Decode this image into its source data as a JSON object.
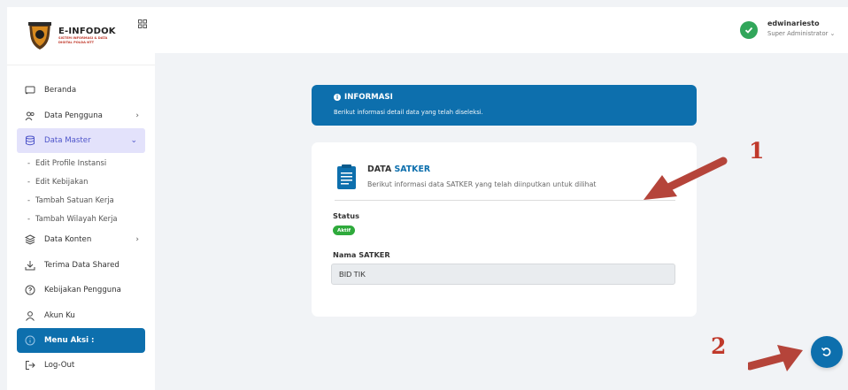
{
  "brand": {
    "title": "E-INFODOK",
    "subtitle": "SISTEM INFORMASI & DATA DIGITAL POLDA NTT"
  },
  "sidebar": {
    "items": [
      {
        "label": "Beranda",
        "icon": "cast-icon"
      },
      {
        "label": "Data Pengguna",
        "icon": "users-icon",
        "chevron": "›"
      },
      {
        "label": "Data Master",
        "icon": "database-icon",
        "chevron": "⌄",
        "active": true
      },
      {
        "label": "Data Konten",
        "icon": "layers-icon",
        "chevron": "›"
      },
      {
        "label": "Terima Data Shared",
        "icon": "download-icon"
      },
      {
        "label": "Kebijakan Pengguna",
        "icon": "help-circle-icon"
      },
      {
        "label": "Akun Ku",
        "icon": "user-icon"
      },
      {
        "label": "Menu Aksi :",
        "icon": "info-icon"
      },
      {
        "label": "Log-Out",
        "icon": "logout-icon"
      }
    ],
    "subitems": [
      {
        "label": "Edit Profile Instansi"
      },
      {
        "label": "Edit Kebijakan"
      },
      {
        "label": "Tambah Satuan Kerja"
      },
      {
        "label": "Tambah Wilayah Kerja"
      }
    ]
  },
  "header": {
    "username": "edwinariesto",
    "role": "Super Administrator ⌄"
  },
  "info": {
    "title": "INFORMASI",
    "subtitle": "Berikut informasi detail data yang telah diseleksi."
  },
  "detail": {
    "title_prefix": "DATA ",
    "title_accent": "SATKER",
    "subtitle": "Berikut informasi data SATKER yang telah diinputkan untuk dilihat",
    "status_label": "Status",
    "status_value": "Aktif",
    "nama_label": "Nama SATKER",
    "nama_value": "BID TIK"
  },
  "annotations": {
    "num1": "1",
    "num2": "2"
  },
  "colors": {
    "primary": "#0d6fad",
    "active_bg": "#e3e2fb",
    "active_text": "#4d54c9",
    "success": "#2faa3c",
    "annotation": "#c0392b"
  }
}
